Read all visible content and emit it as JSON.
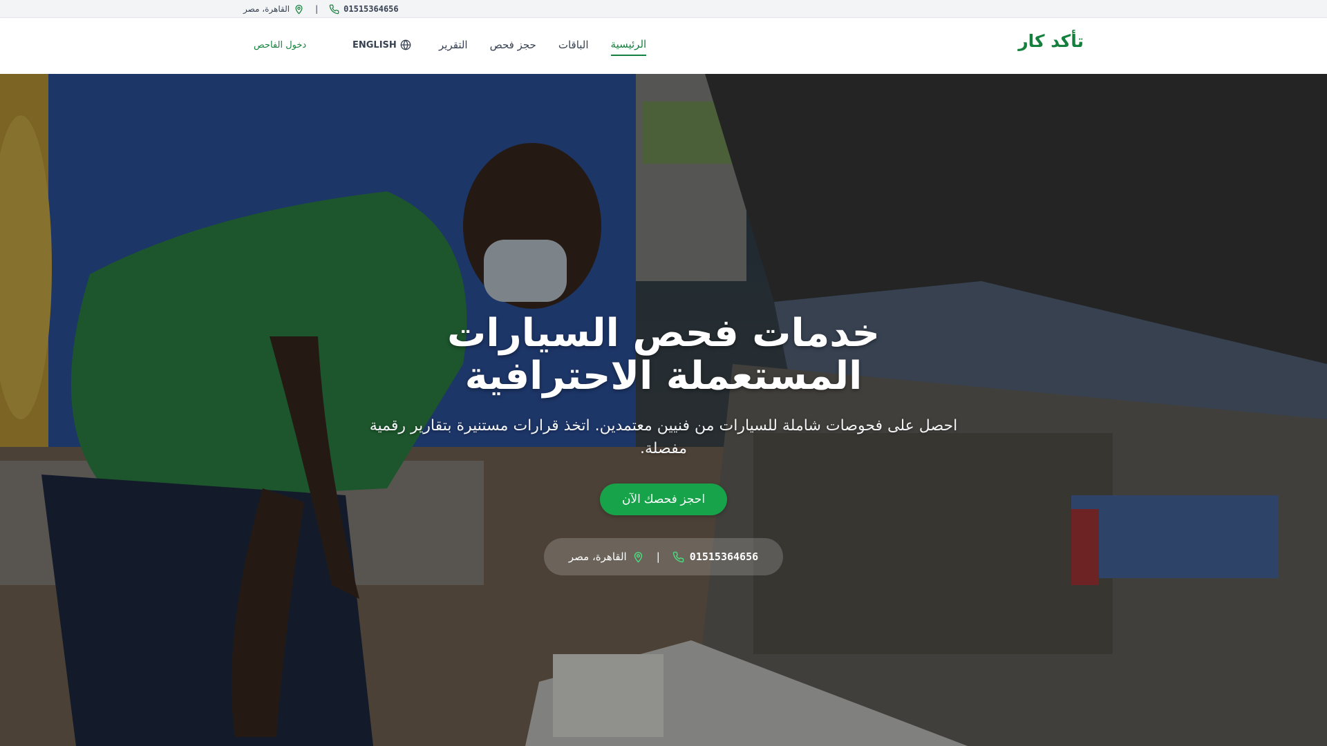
{
  "topbar": {
    "phone": "01515364656",
    "separator": "|",
    "location": "القاهرة، مصر",
    "phone_icon": "phone-icon",
    "location_icon": "map-pin-icon"
  },
  "nav": {
    "brand": "تأكد كار",
    "links": [
      "الرئيسية",
      "الباقات",
      "حجز فحص",
      "التقرير"
    ],
    "active_index": 0,
    "language": "ENGLISH",
    "language_icon": "globe-icon",
    "inspector_login": "دخول الفاحص"
  },
  "hero": {
    "title": "خدمات فحص السيارات المستعملة الاحترافية",
    "subtitle": "احصل على فحوصات شاملة للسيارات من فنيين معتمدين. اتخذ قرارات مستنيرة بتقارير رقمية مفصلة.",
    "cta_label": "احجز فحصك الآن",
    "contact_phone": "01515364656",
    "contact_separator": "|",
    "contact_location": "القاهرة، مصر"
  },
  "colors": {
    "brand_green": "#15803d",
    "cta_green": "#16a34a",
    "topbar_bg": "#f3f4f6",
    "text_gray": "#374151"
  }
}
